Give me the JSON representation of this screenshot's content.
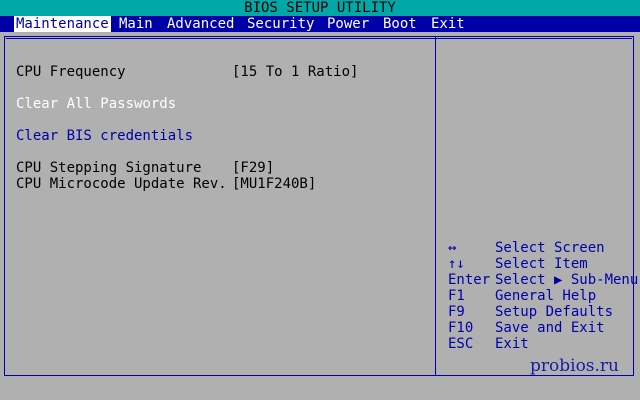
{
  "title": "BIOS SETUP UTILITY",
  "menu": [
    {
      "label": "Maintenance",
      "active": true
    },
    {
      "label": "Main"
    },
    {
      "label": "Advanced"
    },
    {
      "label": "Security"
    },
    {
      "label": "Power"
    },
    {
      "label": "Boot"
    },
    {
      "label": "Exit"
    }
  ],
  "settings": {
    "cpu_frequency": {
      "label": "CPU Frequency",
      "value": "[15 To 1 Ratio]"
    },
    "clear_passwords": {
      "label": "Clear All Passwords"
    },
    "clear_bis": {
      "label": "Clear BIS credentials"
    },
    "stepping": {
      "label": "CPU Stepping Signature",
      "value": "[F29]"
    },
    "microcode": {
      "label": "CPU Microcode Update Rev.",
      "value": "[MU1F240B]"
    }
  },
  "help": [
    {
      "key": "↔",
      "desc": "Select Screen"
    },
    {
      "key": "↑↓",
      "desc": "Select Item"
    },
    {
      "key": "Enter",
      "desc": "Select ▶ Sub-Menu"
    },
    {
      "key": "F1",
      "desc": "General Help"
    },
    {
      "key": "F9",
      "desc": "Setup Defaults"
    },
    {
      "key": "F10",
      "desc": "Save and Exit"
    },
    {
      "key": "ESC",
      "desc": "Exit"
    }
  ],
  "watermark": "probios.ru",
  "colors": {
    "background": "#b0b0b0",
    "title_bar": "#00a8a8",
    "menu_bar": "#0000a8",
    "highlight_text": "#ffffff",
    "accent_text": "#0000a8"
  }
}
